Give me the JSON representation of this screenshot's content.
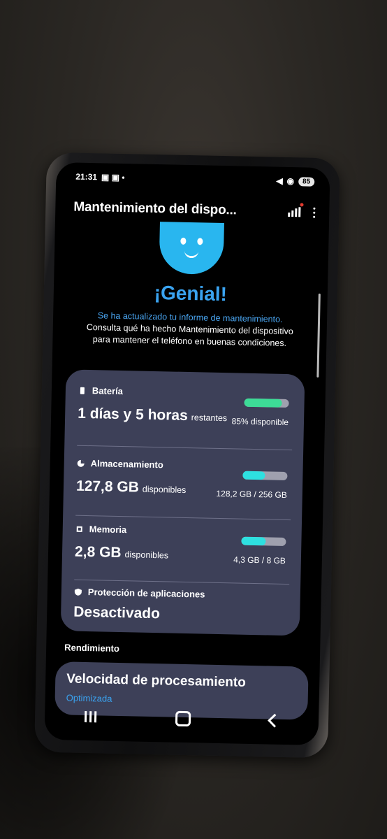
{
  "status_bar": {
    "time": "21:31",
    "battery": "85"
  },
  "app_bar": {
    "title": "Mantenimiento del dispo..."
  },
  "hero": {
    "headline": "¡Genial!",
    "updated": "Se ha actualizado tu informe de mantenimiento.",
    "description": "Consulta qué ha hecho Mantenimiento del dispositivo para mantener el teléfono en buenas condiciones."
  },
  "battery": {
    "label": "Batería",
    "value": "1 días y 5 horas",
    "unit": "restantes",
    "meter_text": "85% disponible",
    "fraction": 0.85,
    "color": "#3ddc97"
  },
  "storage": {
    "label": "Almacenamiento",
    "value": "127,8 GB",
    "unit": "disponibles",
    "meter_text": "128,2 GB / 256 GB",
    "fraction": 0.5,
    "color": "#2ee0e0"
  },
  "memory": {
    "label": "Memoria",
    "value": "2,8 GB",
    "unit": "disponibles",
    "meter_text": "4,3 GB / 8 GB",
    "fraction": 0.54,
    "color": "#2ee0e0"
  },
  "app_protection": {
    "label": "Protección de aplicaciones",
    "value": "Desactivado"
  },
  "performance": {
    "section_label": "Rendimiento",
    "title": "Velocidad de procesamiento",
    "status": "Optimizada"
  },
  "icons": {
    "battery": "battery-icon",
    "storage": "storage-icon",
    "memory": "memory-chip-icon",
    "shield": "shield-icon"
  }
}
